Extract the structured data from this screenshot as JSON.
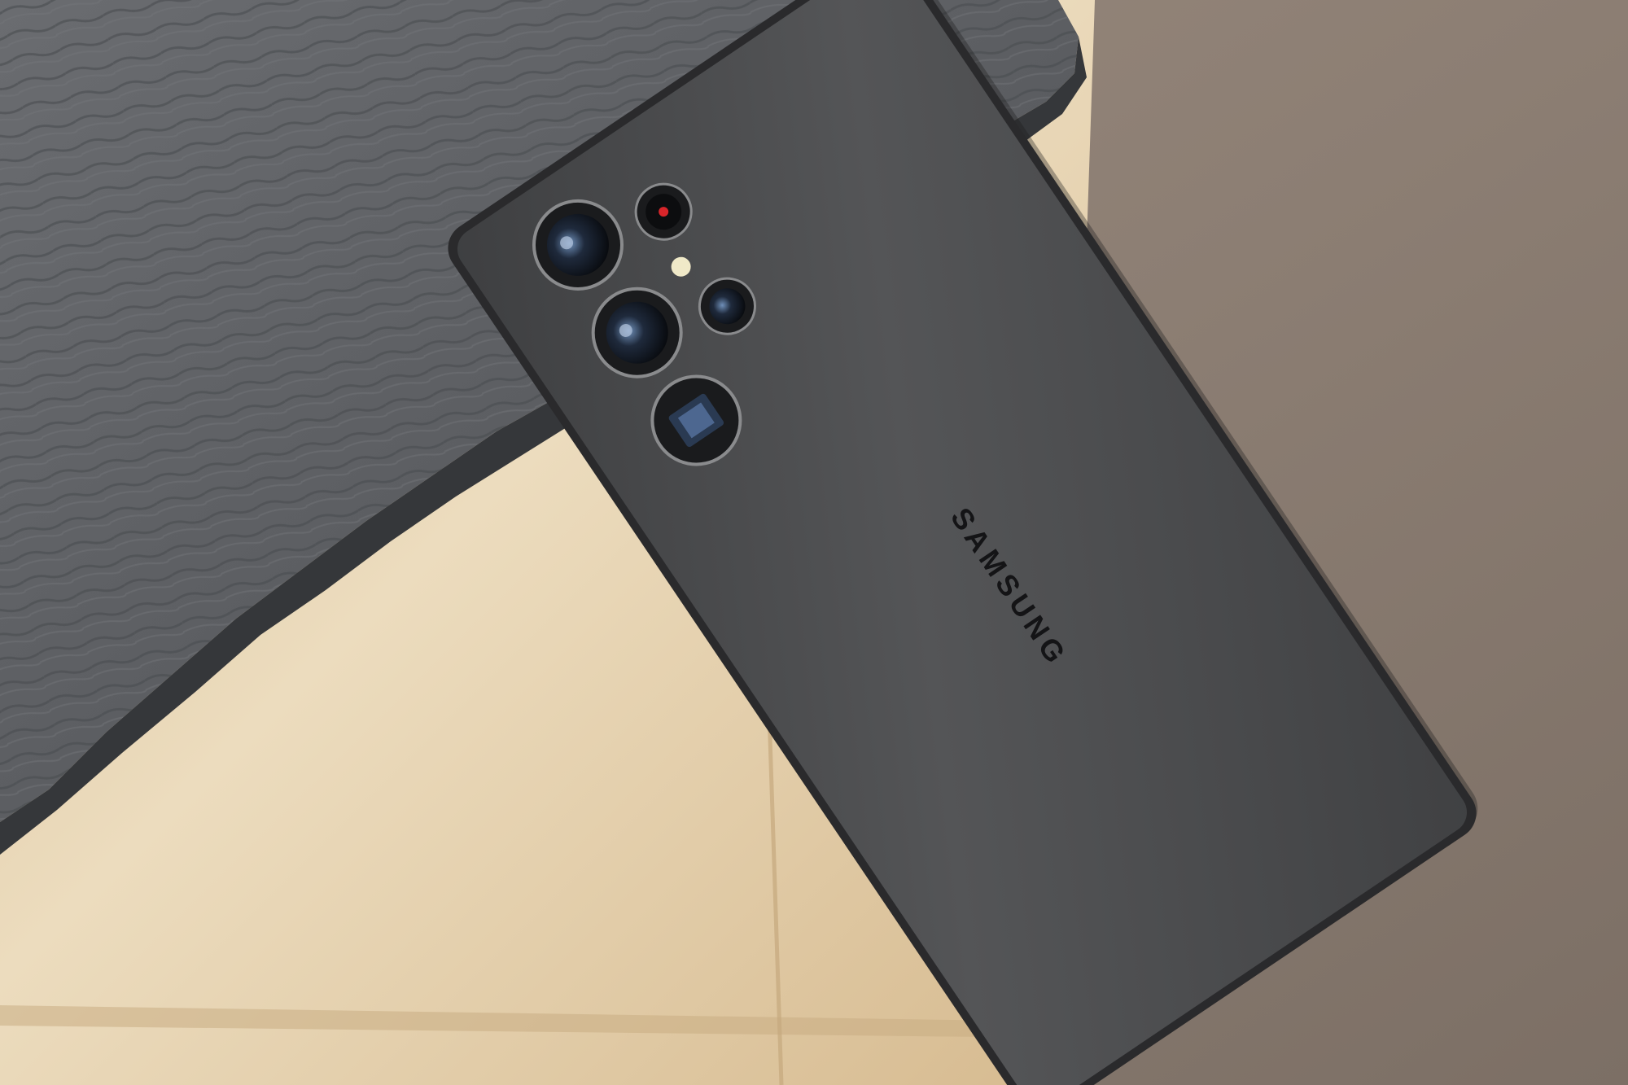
{
  "photo": {
    "subject": "smartphone-back",
    "brand_logo_text": "SAMSUNG",
    "camera_lens_count": 4,
    "colors": {
      "backdrop": "#8c7e73",
      "wood": "#dcc29a",
      "wood_light": "#efe0c6",
      "slate": "#5e6064",
      "slate_dark": "#3e4044",
      "phone_body": "#4c4d4f",
      "phone_frame": "#2a2a2c",
      "lens_ring": "#1a1b1d",
      "logo": "#141416",
      "flash": "#f0e9c8",
      "sensor_red": "#d8252a"
    }
  }
}
